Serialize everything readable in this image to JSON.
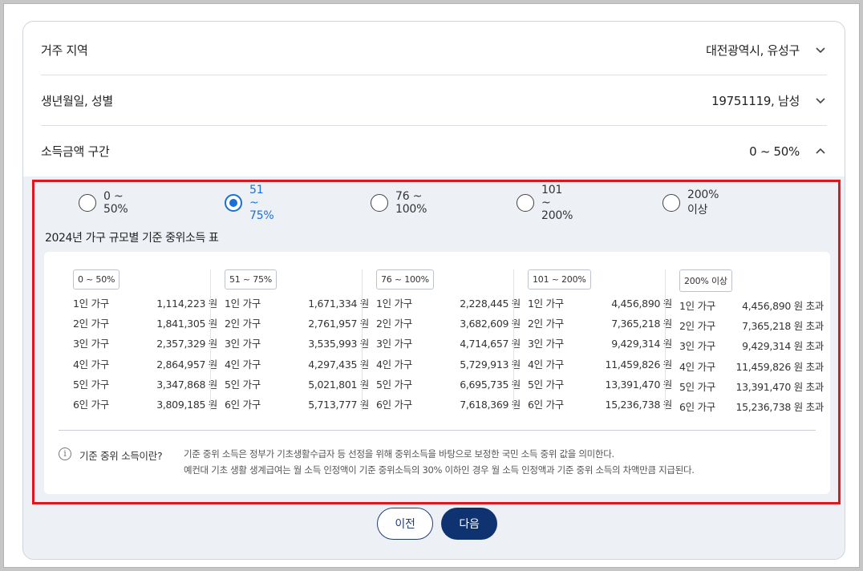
{
  "accordion": [
    {
      "label": "거주 지역",
      "value": "대전광역시, 유성구",
      "icon": "chevron-down-icon"
    },
    {
      "label": "생년월일, 성별",
      "value": "19751119, 남성",
      "icon": "chevron-down-icon"
    },
    {
      "label": "소득금액 구간",
      "value": "0 ~ 50%",
      "icon": "chevron-up-icon"
    }
  ],
  "radios": [
    {
      "label": "0 ~ 50%",
      "selected": false
    },
    {
      "label": "51 ~ 75%",
      "selected": true
    },
    {
      "label": "76 ~ 100%",
      "selected": false
    },
    {
      "label": "101 ~ 200%",
      "selected": false
    },
    {
      "label": "200% 이상",
      "selected": false
    }
  ],
  "table_title": "2024년 가구 규모별 기준 중위소득 표",
  "income_columns": [
    {
      "badge": "0 ~ 50%",
      "rows": [
        {
          "household": "1인 가구",
          "amount": "1,114,223 원"
        },
        {
          "household": "2인 가구",
          "amount": "1,841,305 원"
        },
        {
          "household": "3인 가구",
          "amount": "2,357,329 원"
        },
        {
          "household": "4인 가구",
          "amount": "2,864,957 원"
        },
        {
          "household": "5인 가구",
          "amount": "3,347,868 원"
        },
        {
          "household": "6인 가구",
          "amount": "3,809,185 원"
        }
      ]
    },
    {
      "badge": "51 ~ 75%",
      "rows": [
        {
          "household": "1인 가구",
          "amount": "1,671,334 원"
        },
        {
          "household": "2인 가구",
          "amount": "2,761,957 원"
        },
        {
          "household": "3인 가구",
          "amount": "3,535,993 원"
        },
        {
          "household": "4인 가구",
          "amount": "4,297,435 원"
        },
        {
          "household": "5인 가구",
          "amount": "5,021,801 원"
        },
        {
          "household": "6인 가구",
          "amount": "5,713,777 원"
        }
      ]
    },
    {
      "badge": "76 ~ 100%",
      "rows": [
        {
          "household": "1인 가구",
          "amount": "2,228,445 원"
        },
        {
          "household": "2인 가구",
          "amount": "3,682,609 원"
        },
        {
          "household": "3인 가구",
          "amount": "4,714,657 원"
        },
        {
          "household": "4인 가구",
          "amount": "5,729,913 원"
        },
        {
          "household": "5인 가구",
          "amount": "6,695,735 원"
        },
        {
          "household": "6인 가구",
          "amount": "7,618,369 원"
        }
      ]
    },
    {
      "badge": "101 ~ 200%",
      "rows": [
        {
          "household": "1인 가구",
          "amount": "4,456,890 원"
        },
        {
          "household": "2인 가구",
          "amount": "7,365,218 원"
        },
        {
          "household": "3인 가구",
          "amount": "9,429,314 원"
        },
        {
          "household": "4인 가구",
          "amount": "11,459,826 원"
        },
        {
          "household": "5인 가구",
          "amount": "13,391,470 원"
        },
        {
          "household": "6인 가구",
          "amount": "15,236,738 원"
        }
      ]
    },
    {
      "badge": "200% 이상",
      "rows": [
        {
          "household": "1인 가구",
          "amount": "4,456,890 원 초과"
        },
        {
          "household": "2인 가구",
          "amount": "7,365,218 원 초과"
        },
        {
          "household": "3인 가구",
          "amount": "9,429,314 원 초과"
        },
        {
          "household": "4인 가구",
          "amount": "11,459,826 원 초과"
        },
        {
          "household": "5인 가구",
          "amount": "13,391,470 원 초과"
        },
        {
          "household": "6인 가구",
          "amount": "15,236,738 원 초과"
        }
      ]
    }
  ],
  "info": {
    "icon": "info-icon",
    "icon_glyph": "i",
    "title": "기준 중위 소득이란?",
    "line1": "기준 중위 소득은 정부가 기초생활수급자 등 선정을 위해 중위소득을 바탕으로 보정한 국민 소득 중위 값을 의미한다.",
    "line2": "예컨대 기초 생활 생계급여는 월 소득 인정액이 기준 중위소득의 30% 이하인 경우 월 소득 인정액과 기준 중위 소득의 차액만큼 지급된다."
  },
  "buttons": {
    "prev": "이전",
    "next": "다음"
  },
  "colors": {
    "accent": "#1a6fd8",
    "primary_button": "#0f3370",
    "highlight_border": "#e3141b"
  }
}
